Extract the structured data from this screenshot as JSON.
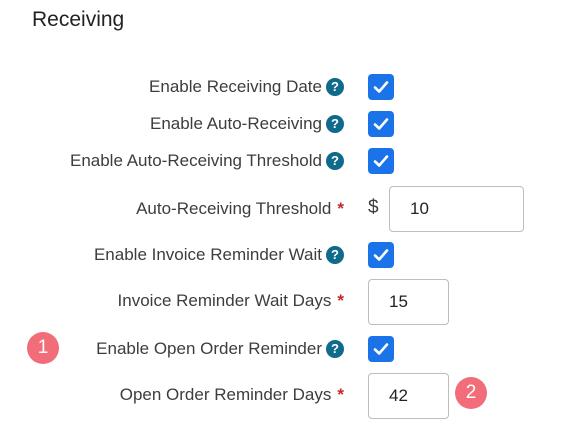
{
  "section": {
    "title": "Receiving"
  },
  "settings": [
    {
      "label": "Enable Receiving Date",
      "type": "checkbox",
      "checked": true,
      "help": "?"
    },
    {
      "label": "Enable Auto-Receiving",
      "type": "checkbox",
      "checked": true,
      "help": "?"
    },
    {
      "label": "Enable Auto-Receiving Threshold",
      "type": "checkbox",
      "checked": true,
      "help": "?"
    },
    {
      "label": "Auto-Receiving Threshold",
      "type": "input",
      "required_marker": "*",
      "prefix": "$",
      "value": "10"
    },
    {
      "label": "Enable Invoice Reminder Wait",
      "type": "checkbox",
      "checked": true,
      "help": "?"
    },
    {
      "label": "Invoice Reminder Wait Days",
      "type": "input",
      "required_marker": "*",
      "value": "15"
    },
    {
      "label": "Enable Open Order Reminder",
      "type": "checkbox",
      "checked": true,
      "help": "?"
    },
    {
      "label": "Open Order Reminder Days",
      "type": "input",
      "required_marker": "*",
      "value": "42"
    }
  ],
  "callouts": [
    {
      "number": "1"
    },
    {
      "number": "2"
    }
  ],
  "colors": {
    "checkbox": "#1a73e8",
    "help_icon": "#0f6a8c",
    "required": "#c62828",
    "callout": "#f26d7a"
  }
}
